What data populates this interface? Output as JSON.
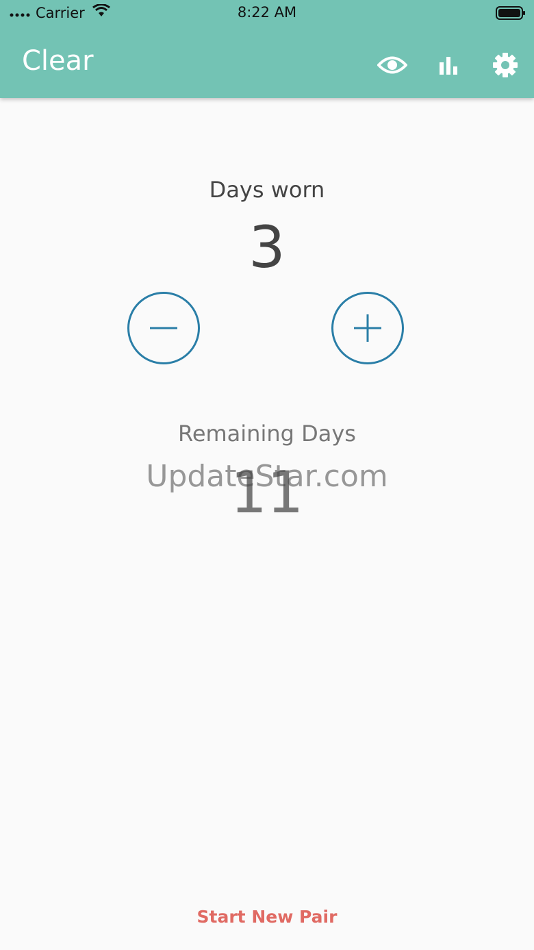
{
  "status_bar": {
    "carrier": "Carrier",
    "time": "8:22 AM"
  },
  "appbar": {
    "title": "Clear",
    "icons": [
      "eye-icon",
      "bar-chart-icon",
      "gear-icon"
    ]
  },
  "counter": {
    "label": "Days worn",
    "value": "3"
  },
  "remaining": {
    "label": "Remaining Days",
    "value": "11"
  },
  "watermark": "UpdateStar.com",
  "actions": {
    "start_new_pair": "Start New Pair"
  },
  "colors": {
    "appbar": "#73c3b4",
    "button_outline": "#2a7ea7",
    "action": "#e06a63"
  }
}
